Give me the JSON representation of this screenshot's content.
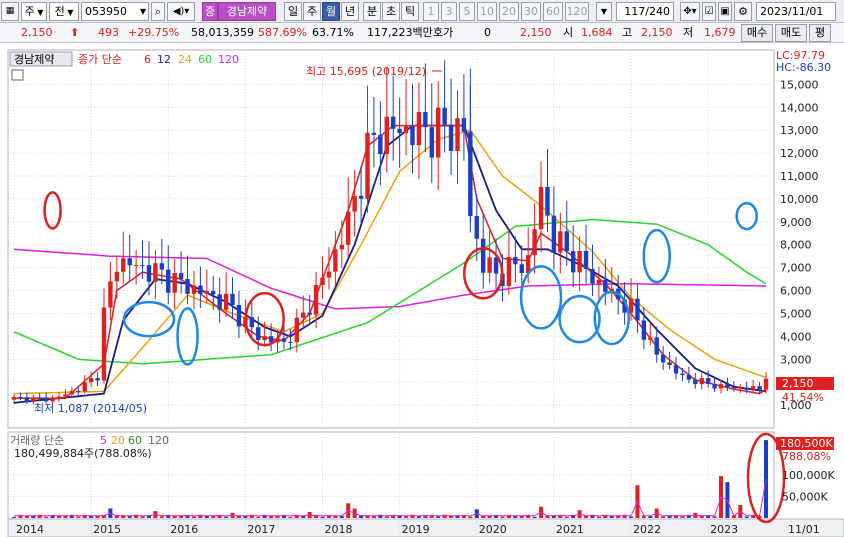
{
  "toolbar": {
    "type_label": "주",
    "jeon_label": "전",
    "code": "053950",
    "stock_badge": "증",
    "stock_name": "경남제약",
    "periods": [
      "일",
      "주",
      "월",
      "년",
      "분",
      "초",
      "틱"
    ],
    "active_period": "월",
    "intervals": [
      "1",
      "3",
      "5",
      "10",
      "20",
      "30",
      "60",
      "120"
    ],
    "count": "117/240",
    "date": "2023/11/01"
  },
  "quote": {
    "price": "2,150",
    "change": "493",
    "change_pct": "+29.75%",
    "volume": "58,013,359",
    "volume_pct": "587.69%",
    "turnover": "63.71%",
    "amount": "117,223백만",
    "hoga_label": "호가",
    "hoga_value": "0",
    "hoga_price": "2,150",
    "open_label": "시",
    "open": "1,684",
    "high_label": "고",
    "high": "2,150",
    "low_label": "저",
    "low": "1,679",
    "buy_label": "매수",
    "sell_label": "매도",
    "flat_label": "평"
  },
  "chart_data": {
    "type": "candlestick",
    "stock_label": "경남제약",
    "legend_price_label": "종가 단순",
    "legend_volume_label": "거래량 단순",
    "ma_periods": [
      "6",
      "12",
      "24",
      "60",
      "120"
    ],
    "vol_ma_periods": [
      "5",
      "20",
      "60",
      "120"
    ],
    "ma_colors": {
      "6": "#e0201e",
      "12": "#1a1a8c",
      "24": "#f0a20a",
      "60": "#2bd42b",
      "120": "#e01ee0"
    },
    "ylim": [
      0,
      16500
    ],
    "y_ticks": [
      1000,
      2000,
      3000,
      4000,
      5000,
      6000,
      7000,
      8000,
      9000,
      10000,
      11000,
      12000,
      13000,
      14000,
      15000
    ],
    "y_tick_labels": [
      "1,000",
      "2,000",
      "3,000",
      "4,000",
      "5,000",
      "6,000",
      "7,000",
      "8,000",
      "9,000",
      "10,000",
      "11,000",
      "12,000",
      "13,000",
      "14,000",
      "15,000"
    ],
    "x_labels": [
      "2014",
      "2015",
      "2016",
      "2017",
      "2018",
      "2019",
      "2020",
      "2021",
      "2022",
      "2023",
      "11/01"
    ],
    "high_annotation": "최고 15,695 (2019/12)",
    "low_annotation": "최저 1,087 (2014/05)",
    "lc": "LC:97.79",
    "hc": "HC:-86.30",
    "last_price_tag": "2,150",
    "last_pct_tag": "41.54%",
    "volume_summary": "180,499,884주(788.08%)",
    "volume_tag": "180,500K",
    "volume_pct_tag": "788.08%",
    "vol_ticks": [
      "50,000K",
      "100,000K"
    ],
    "vol_tick_values": [
      50000,
      100000
    ],
    "vol_max": 190000,
    "price_anchors": [
      [
        0,
        1300
      ],
      [
        6,
        1250
      ],
      [
        10,
        1700
      ],
      [
        13,
        2300
      ],
      [
        14,
        5000
      ],
      [
        16,
        7300
      ],
      [
        22,
        6800
      ],
      [
        26,
        6300
      ],
      [
        33,
        5500
      ],
      [
        38,
        4000
      ],
      [
        42,
        3700
      ],
      [
        45,
        4900
      ],
      [
        49,
        7000
      ],
      [
        52,
        9000
      ],
      [
        55,
        12000
      ],
      [
        57,
        13000
      ],
      [
        70,
        13000
      ],
      [
        71,
        9200
      ],
      [
        73,
        7200
      ],
      [
        75,
        6700
      ],
      [
        80,
        7300
      ],
      [
        82,
        10300
      ],
      [
        84,
        8200
      ],
      [
        88,
        7200
      ],
      [
        91,
        6300
      ],
      [
        96,
        5200
      ],
      [
        100,
        3200
      ],
      [
        104,
        2200
      ],
      [
        110,
        1800
      ],
      [
        116,
        1700
      ],
      [
        117,
        2150
      ]
    ],
    "ma6_anchors": [
      [
        0,
        1300
      ],
      [
        8,
        1300
      ],
      [
        14,
        2800
      ],
      [
        16,
        6000
      ],
      [
        20,
        6800
      ],
      [
        26,
        6500
      ],
      [
        33,
        5000
      ],
      [
        38,
        4000
      ],
      [
        42,
        3800
      ],
      [
        46,
        5000
      ],
      [
        52,
        9500
      ],
      [
        55,
        12300
      ],
      [
        59,
        13200
      ],
      [
        70,
        13200
      ],
      [
        72,
        10000
      ],
      [
        76,
        7400
      ],
      [
        80,
        7300
      ],
      [
        82,
        8500
      ],
      [
        86,
        7700
      ],
      [
        92,
        6300
      ],
      [
        96,
        5000
      ],
      [
        101,
        3200
      ],
      [
        106,
        2100
      ],
      [
        112,
        1700
      ],
      [
        116,
        1500
      ],
      [
        117,
        1700
      ]
    ],
    "ma12_anchors": [
      [
        0,
        1100
      ],
      [
        14,
        1500
      ],
      [
        17,
        4700
      ],
      [
        22,
        6500
      ],
      [
        27,
        6300
      ],
      [
        33,
        5500
      ],
      [
        39,
        4400
      ],
      [
        43,
        4000
      ],
      [
        48,
        4900
      ],
      [
        53,
        8000
      ],
      [
        58,
        12300
      ],
      [
        62,
        13200
      ],
      [
        70,
        13200
      ],
      [
        75,
        9500
      ],
      [
        79,
        7800
      ],
      [
        83,
        7800
      ],
      [
        89,
        7000
      ],
      [
        94,
        6200
      ],
      [
        100,
        4300
      ],
      [
        106,
        2600
      ],
      [
        112,
        1800
      ],
      [
        117,
        1600
      ]
    ],
    "ma24_anchors": [
      [
        0,
        1500
      ],
      [
        14,
        1600
      ],
      [
        20,
        3500
      ],
      [
        27,
        5800
      ],
      [
        34,
        5000
      ],
      [
        42,
        4200
      ],
      [
        48,
        5000
      ],
      [
        54,
        8000
      ],
      [
        60,
        11200
      ],
      [
        66,
        12600
      ],
      [
        71,
        13000
      ],
      [
        76,
        11000
      ],
      [
        82,
        9700
      ],
      [
        90,
        7700
      ],
      [
        96,
        5700
      ],
      [
        102,
        4300
      ],
      [
        109,
        3000
      ],
      [
        116,
        2300
      ],
      [
        117,
        2200
      ]
    ],
    "ma60_anchors": [
      [
        0,
        4200
      ],
      [
        10,
        3000
      ],
      [
        20,
        2800
      ],
      [
        40,
        3200
      ],
      [
        55,
        4600
      ],
      [
        70,
        7200
      ],
      [
        78,
        8800
      ],
      [
        90,
        9100
      ],
      [
        100,
        8900
      ],
      [
        108,
        8000
      ],
      [
        114,
        6800
      ],
      [
        117,
        6300
      ]
    ],
    "ma120_anchors": [
      [
        0,
        7800
      ],
      [
        15,
        7500
      ],
      [
        30,
        7400
      ],
      [
        40,
        6100
      ],
      [
        50,
        5200
      ],
      [
        60,
        5300
      ],
      [
        70,
        5800
      ],
      [
        80,
        6200
      ],
      [
        95,
        6300
      ],
      [
        117,
        6200
      ]
    ],
    "volume_spikes": [
      [
        15,
        22000
      ],
      [
        22,
        16000
      ],
      [
        34,
        12000
      ],
      [
        46,
        14000
      ],
      [
        52,
        34000
      ],
      [
        53,
        22000
      ],
      [
        72,
        20000
      ],
      [
        82,
        26000
      ],
      [
        88,
        18000
      ],
      [
        97,
        76000
      ],
      [
        100,
        22000
      ],
      [
        106,
        12000
      ],
      [
        110,
        97000
      ],
      [
        111,
        83000
      ],
      [
        113,
        30000
      ],
      [
        117,
        180500
      ]
    ],
    "circles_blue": [
      [
        21,
        9500,
        25,
        17
      ],
      [
        27,
        8000,
        10,
        28
      ],
      [
        82,
        11400,
        20,
        31
      ],
      [
        88,
        9500,
        20,
        23
      ],
      [
        93,
        9600,
        17,
        26
      ],
      [
        100,
        15000,
        13,
        26
      ],
      [
        114,
        18500,
        10,
        13
      ]
    ],
    "circles_red": [
      [
        6,
        19000,
        8,
        18
      ],
      [
        39,
        9500,
        19,
        26
      ],
      [
        73,
        13500,
        19,
        25
      ]
    ],
    "circle_volume_red": [
      117,
      470,
      18,
      44
    ]
  }
}
